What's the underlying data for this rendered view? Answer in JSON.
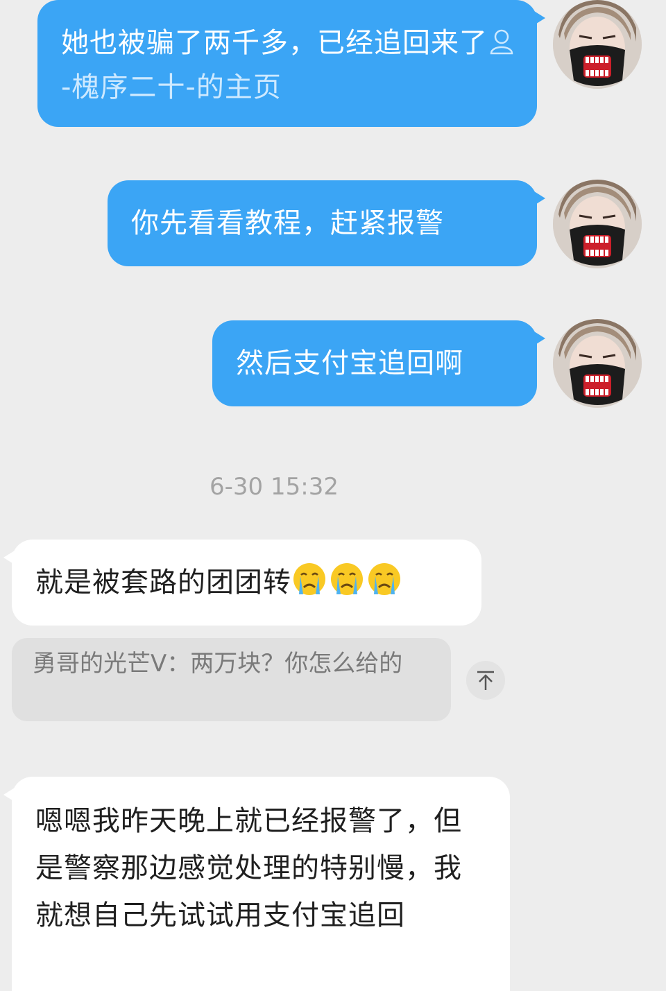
{
  "conversation": {
    "messages_out": [
      {
        "text": "她也被骗了两千多，已经追回来了",
        "mention_icon": "user-icon",
        "mention": "-槐序二十-的主页"
      },
      {
        "text": "你先看看教程，赶紧报警"
      },
      {
        "text": "然后支付宝追回啊"
      }
    ],
    "timestamp": "6-30 15:32",
    "messages_in": [
      {
        "text": "就是被套路的团团转",
        "emojis": [
          "crying-face-icon",
          "crying-face-icon",
          "crying-face-icon"
        ]
      },
      {
        "text": "嗯嗯我昨天晚上就已经报警了，但是警察那边感觉处理的特别慢，我就想自己先试试用支付宝追回"
      }
    ],
    "quote": {
      "text": "勇哥的光芒V：两万块？你怎么给的"
    },
    "scroll_top_icon": "arrow-up-to-top-icon"
  },
  "colors": {
    "background": "#ededed",
    "outgoing_bubble": "#3ba5f5",
    "incoming_bubble": "#ffffff",
    "quote_bubble": "#e0e0e0"
  }
}
